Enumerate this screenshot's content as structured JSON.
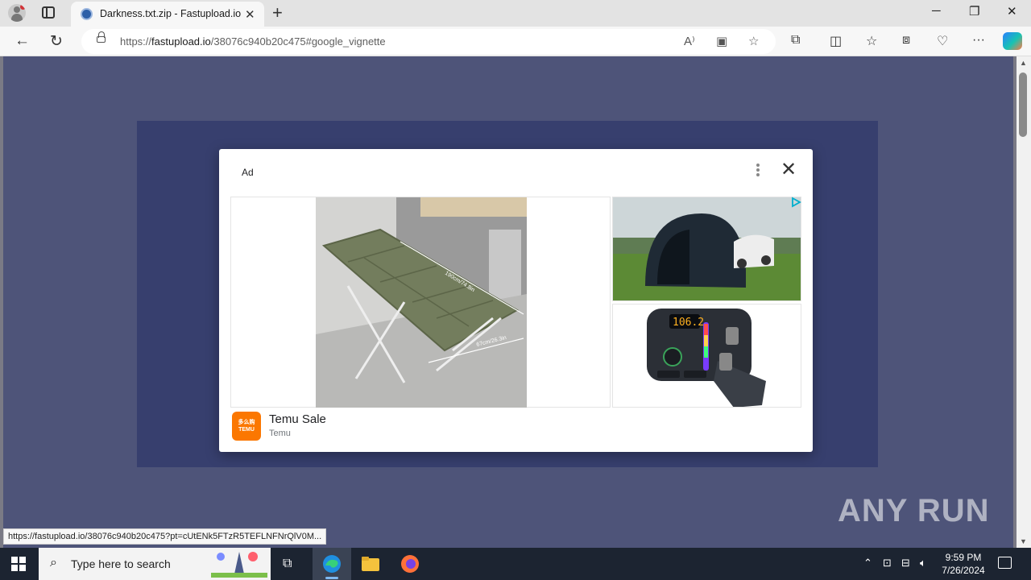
{
  "browser": {
    "tab_title": "Darkness.txt.zip - Fastupload.io",
    "tab_close": "✕",
    "new_tab": "+",
    "window_controls": [
      "─",
      "❐",
      "✕"
    ],
    "url_domain": "fastupload.io",
    "url_prefix": "https://",
    "url_path": "/38076c940b20c475#google_vignette",
    "status_url": "https://fastupload.io/38076c940b20c475?pt=cUtENk5FTzR5TEFLNFNrQlV0M..."
  },
  "ad": {
    "label": "Ad",
    "close": "✕",
    "cot_dim_1": "190cm/74.8in",
    "cot_dim_2": "67cm/26.3in",
    "screen_reading": "106.2",
    "brand_name": "Temu Sale",
    "brand_sub": "Temu",
    "logo_line1": "多么购",
    "logo_line2": "TEMU"
  },
  "taskbar": {
    "search_placeholder": "Type here to search",
    "time": "9:59 PM",
    "date": "7/26/2024"
  },
  "watermark": "ANY RUN",
  "colors": {
    "tab_strip": "#e3e3e3",
    "taskbar": "#1c2431",
    "temu_orange": "#fb7701",
    "page_overlay": "#2a3570"
  }
}
